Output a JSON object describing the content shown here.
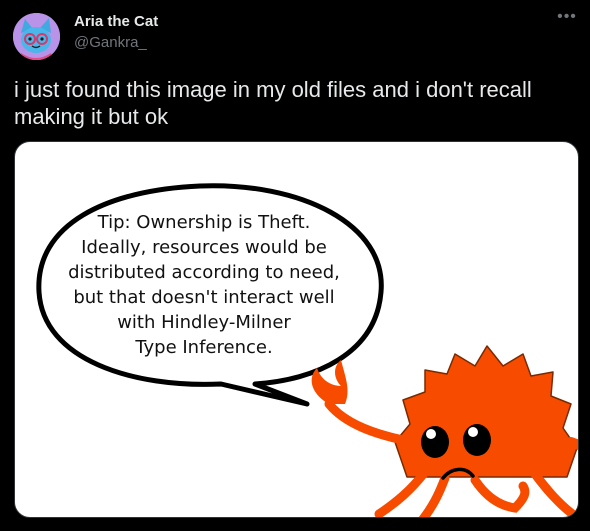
{
  "author": {
    "name": "Aria the Cat",
    "handle": "@Gankra_",
    "avatar_icon": "cat-avatar-icon"
  },
  "more_icon": "more-dots-icon",
  "tweet": {
    "text": "i just found this image in my old files and i don't recall making it but ok"
  },
  "image": {
    "bubble_lines": [
      "Tip: Ownership is Theft.",
      "Ideally, resources would be",
      "distributed according to need,",
      "but that doesn't interact well",
      "with Hindley-Milner",
      "Type Inference."
    ],
    "mascot_icon": "crab-mascot-icon",
    "crab_color": "#f74c00"
  },
  "colors": {
    "background": "#000000",
    "text": "#e7e9ea",
    "secondary": "#71767b",
    "border": "#2f3336"
  }
}
